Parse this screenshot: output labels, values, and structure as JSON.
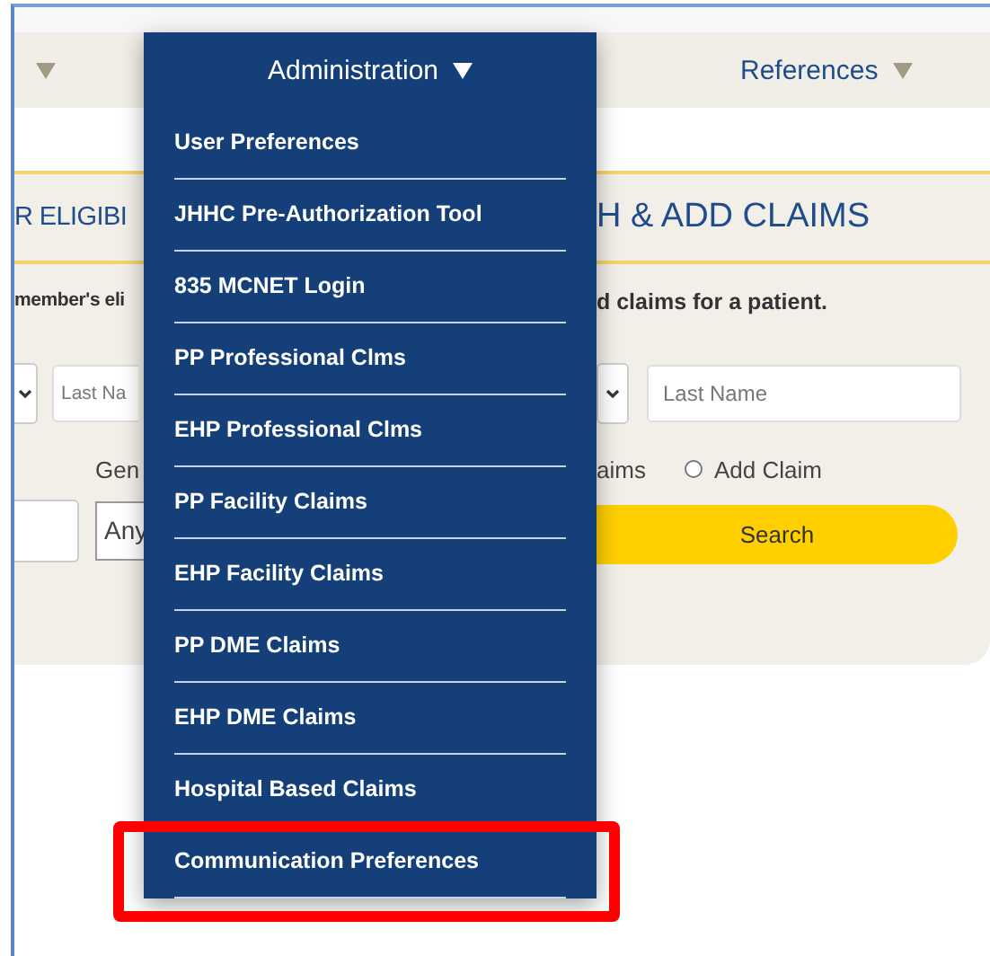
{
  "nav": {
    "items": [
      {
        "label": "Administration",
        "expanded": true
      },
      {
        "label": "References",
        "expanded": false
      }
    ]
  },
  "menu": {
    "items": [
      {
        "label": "User Preferences",
        "highlighted": false
      },
      {
        "label": "JHHC Pre-Authorization Tool",
        "highlighted": false
      },
      {
        "label": "835 MCNET Login",
        "highlighted": false
      },
      {
        "label": "PP Professional Clms",
        "highlighted": false
      },
      {
        "label": "EHP Professional Clms",
        "highlighted": false
      },
      {
        "label": "PP Facility Claims",
        "highlighted": false
      },
      {
        "label": "EHP Facility Claims",
        "highlighted": false
      },
      {
        "label": "PP DME Claims",
        "highlighted": false
      },
      {
        "label": "EHP DME Claims",
        "highlighted": false
      },
      {
        "label": "Hospital Based Claims",
        "highlighted": false
      },
      {
        "label": "Communication Preferences",
        "highlighted": true
      }
    ]
  },
  "banner": {
    "title_left": "R ELIGIBI",
    "title_right": "H & ADD CLAIMS"
  },
  "description": {
    "left": "member's eli",
    "right": "d claims for a patient."
  },
  "form": {
    "left_name_field": {
      "placeholder": "Last Na"
    },
    "right_name_field": {
      "placeholder": "Last Name"
    },
    "gender_label": "Gen",
    "gender_select": {
      "value": "Any"
    },
    "radio_label_partial": "aims",
    "radios": [
      {
        "label": "Add Claim",
        "selected": false
      }
    ],
    "search_button": "Search"
  }
}
